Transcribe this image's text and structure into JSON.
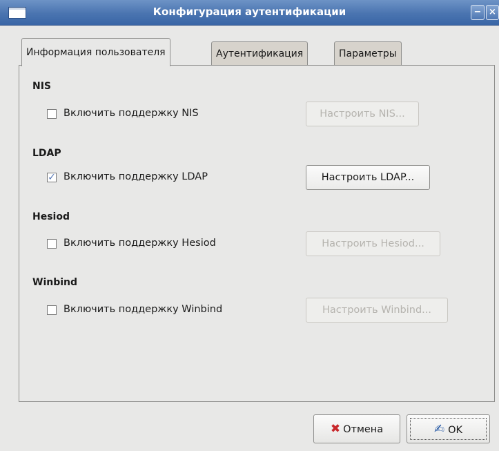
{
  "window": {
    "title": "Конфигурация аутентификации"
  },
  "tabs": [
    {
      "label": "Информация пользователя",
      "active": true
    },
    {
      "label": "Аутентификация",
      "active": false
    },
    {
      "label": "Параметры",
      "active": false
    }
  ],
  "sections": [
    {
      "title": "NIS",
      "checkbox_label": "Включить поддержку NIS",
      "checked": false,
      "button_label": "Настроить NIS...",
      "button_enabled": false
    },
    {
      "title": "LDAP",
      "checkbox_label": "Включить поддержку LDAP",
      "checked": true,
      "button_label": "Настроить LDAP...",
      "button_enabled": true
    },
    {
      "title": "Hesiod",
      "checkbox_label": "Включить поддержку Hesiod",
      "checked": false,
      "button_label": "Настроить Hesiod...",
      "button_enabled": false
    },
    {
      "title": "Winbind",
      "checkbox_label": "Включить поддержку Winbind",
      "checked": false,
      "button_label": "Настроить Winbind...",
      "button_enabled": false
    }
  ],
  "footer": {
    "cancel_label": "Отмена",
    "ok_label": "OK"
  },
  "icons": {
    "checkmark": "✓",
    "cancel": "✖",
    "ok": "✍",
    "minimize": "−",
    "close": "×"
  },
  "colors": {
    "titlebar": "#4a74b0",
    "cancel_icon": "#c8272b",
    "ok_icon": "#2e5fa8"
  }
}
